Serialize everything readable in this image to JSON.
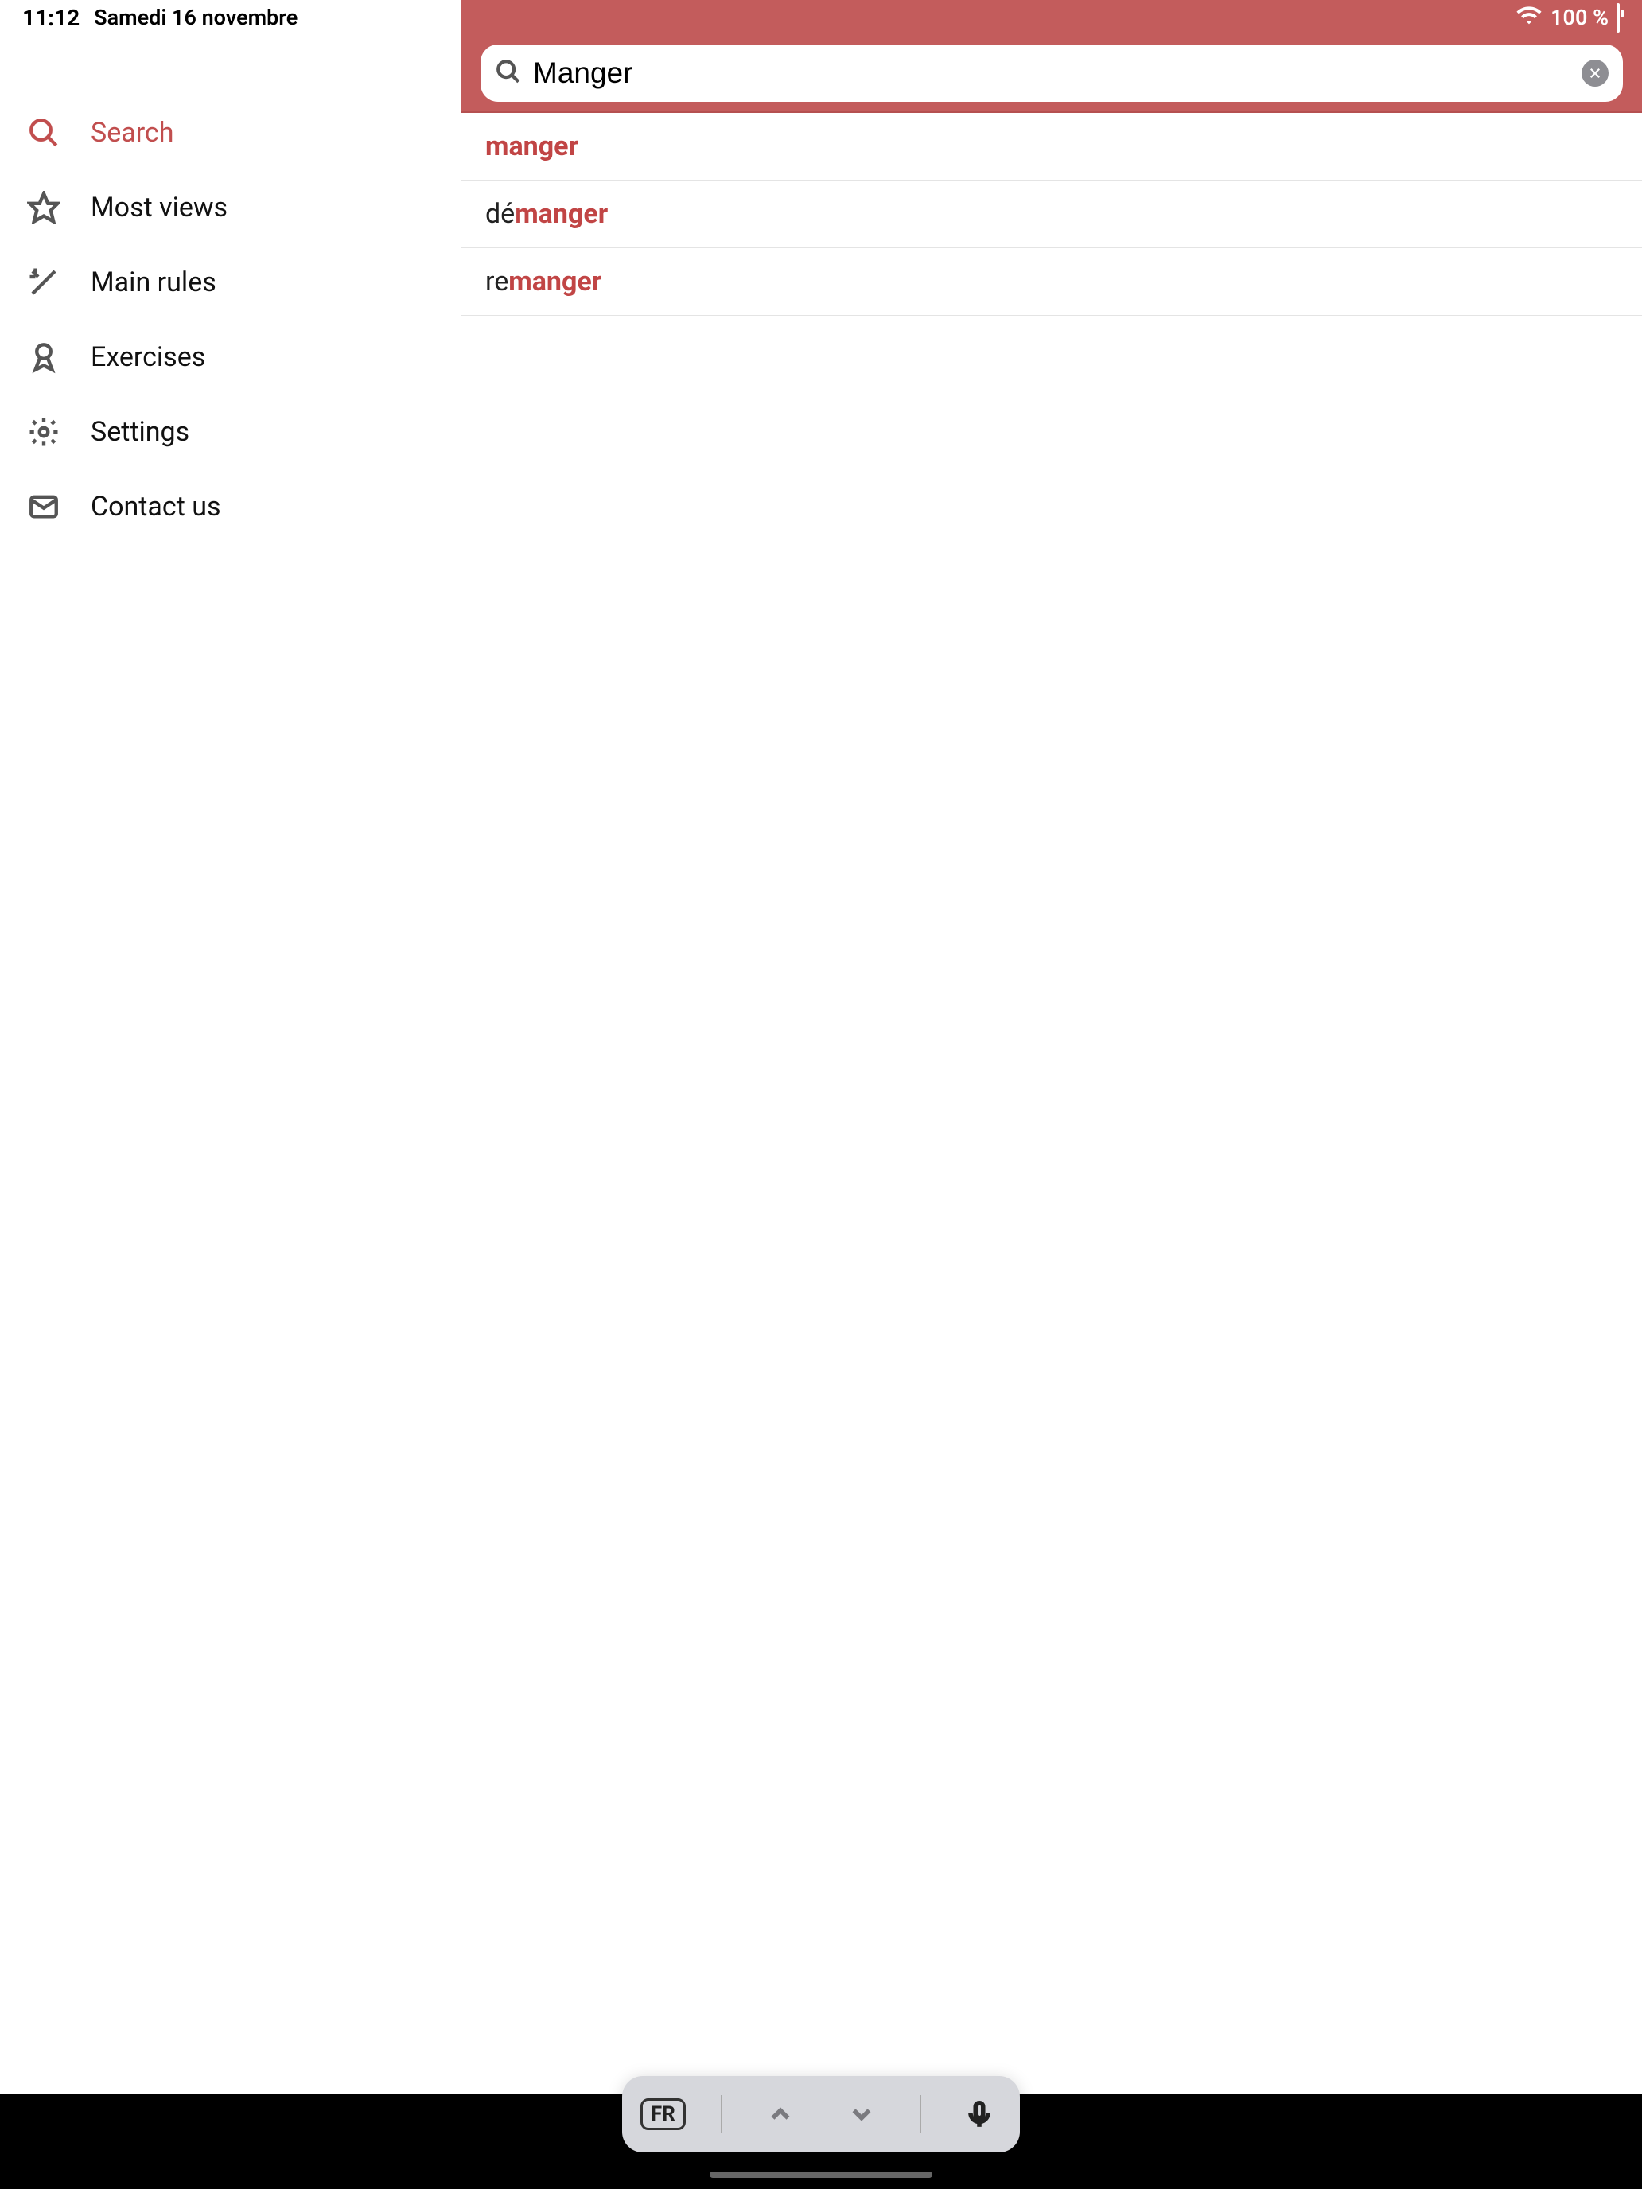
{
  "status": {
    "time": "11:12",
    "date": "Samedi 16 novembre",
    "battery": "100 %"
  },
  "sidebar": {
    "items": [
      {
        "label": "Search",
        "active": true
      },
      {
        "label": "Most views"
      },
      {
        "label": "Main rules"
      },
      {
        "label": "Exercises"
      },
      {
        "label": "Settings"
      },
      {
        "label": "Contact us"
      }
    ]
  },
  "search": {
    "value": "Manger"
  },
  "results": [
    {
      "prefix": "",
      "match": "manger"
    },
    {
      "prefix": "dé",
      "match": "manger"
    },
    {
      "prefix": "re",
      "match": "manger"
    }
  ],
  "keyboard": {
    "lang": "FR"
  }
}
